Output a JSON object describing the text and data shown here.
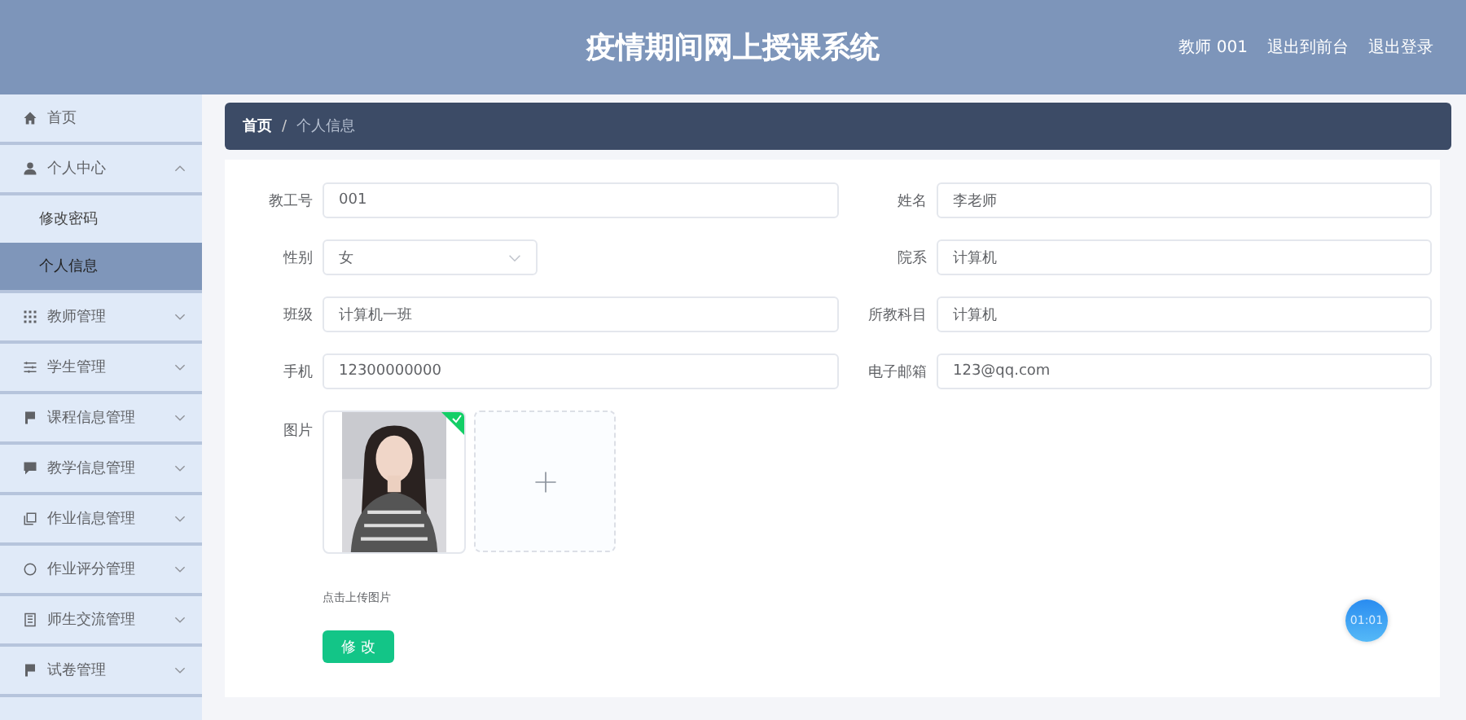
{
  "header": {
    "title": "疫情期间网上授课系统",
    "links": [
      "教师 001",
      "退出到前台",
      "退出登录"
    ]
  },
  "sidebar": {
    "items": [
      {
        "kind": "link",
        "label": "首页",
        "selected": false
      },
      {
        "kind": "group",
        "label": "个人中心",
        "expanded": true,
        "children": [
          {
            "label": "修改密码",
            "selected": false
          },
          {
            "label": "个人信息",
            "selected": true
          }
        ]
      },
      {
        "kind": "group",
        "label": "教师管理",
        "expanded": false
      },
      {
        "kind": "group",
        "label": "学生管理",
        "expanded": false
      },
      {
        "kind": "group",
        "label": "课程信息管理",
        "expanded": false
      },
      {
        "kind": "group",
        "label": "教学信息管理",
        "expanded": false
      },
      {
        "kind": "group",
        "label": "作业信息管理",
        "expanded": false
      },
      {
        "kind": "group",
        "label": "作业评分管理",
        "expanded": false
      },
      {
        "kind": "group",
        "label": "师生交流管理",
        "expanded": false
      },
      {
        "kind": "group",
        "label": "试卷管理",
        "expanded": false
      }
    ]
  },
  "breadcrumb": {
    "separator": "/",
    "items": [
      "首页",
      "个人信息"
    ]
  },
  "form": {
    "rows": [
      [
        {
          "kind": "text",
          "label": "教工号",
          "value": "001"
        },
        {
          "kind": "text",
          "label": "姓名",
          "value": "李老师"
        }
      ],
      [
        {
          "kind": "select",
          "label": "性别",
          "value": "女"
        },
        {
          "kind": "text",
          "label": "院系",
          "value": "计算机"
        }
      ],
      [
        {
          "kind": "text",
          "label": "班级",
          "value": "计算机一班"
        },
        {
          "kind": "text",
          "label": "所教科目",
          "value": "计算机"
        }
      ],
      [
        {
          "kind": "text",
          "label": "手机",
          "value": "12300000000"
        },
        {
          "kind": "text",
          "label": "电子邮箱",
          "value": "123@qq.com"
        }
      ]
    ],
    "picture": {
      "label": "图片",
      "uploaded": true,
      "hint": "点击上传图片"
    },
    "submit": "修 改"
  },
  "timer": "01:01"
}
